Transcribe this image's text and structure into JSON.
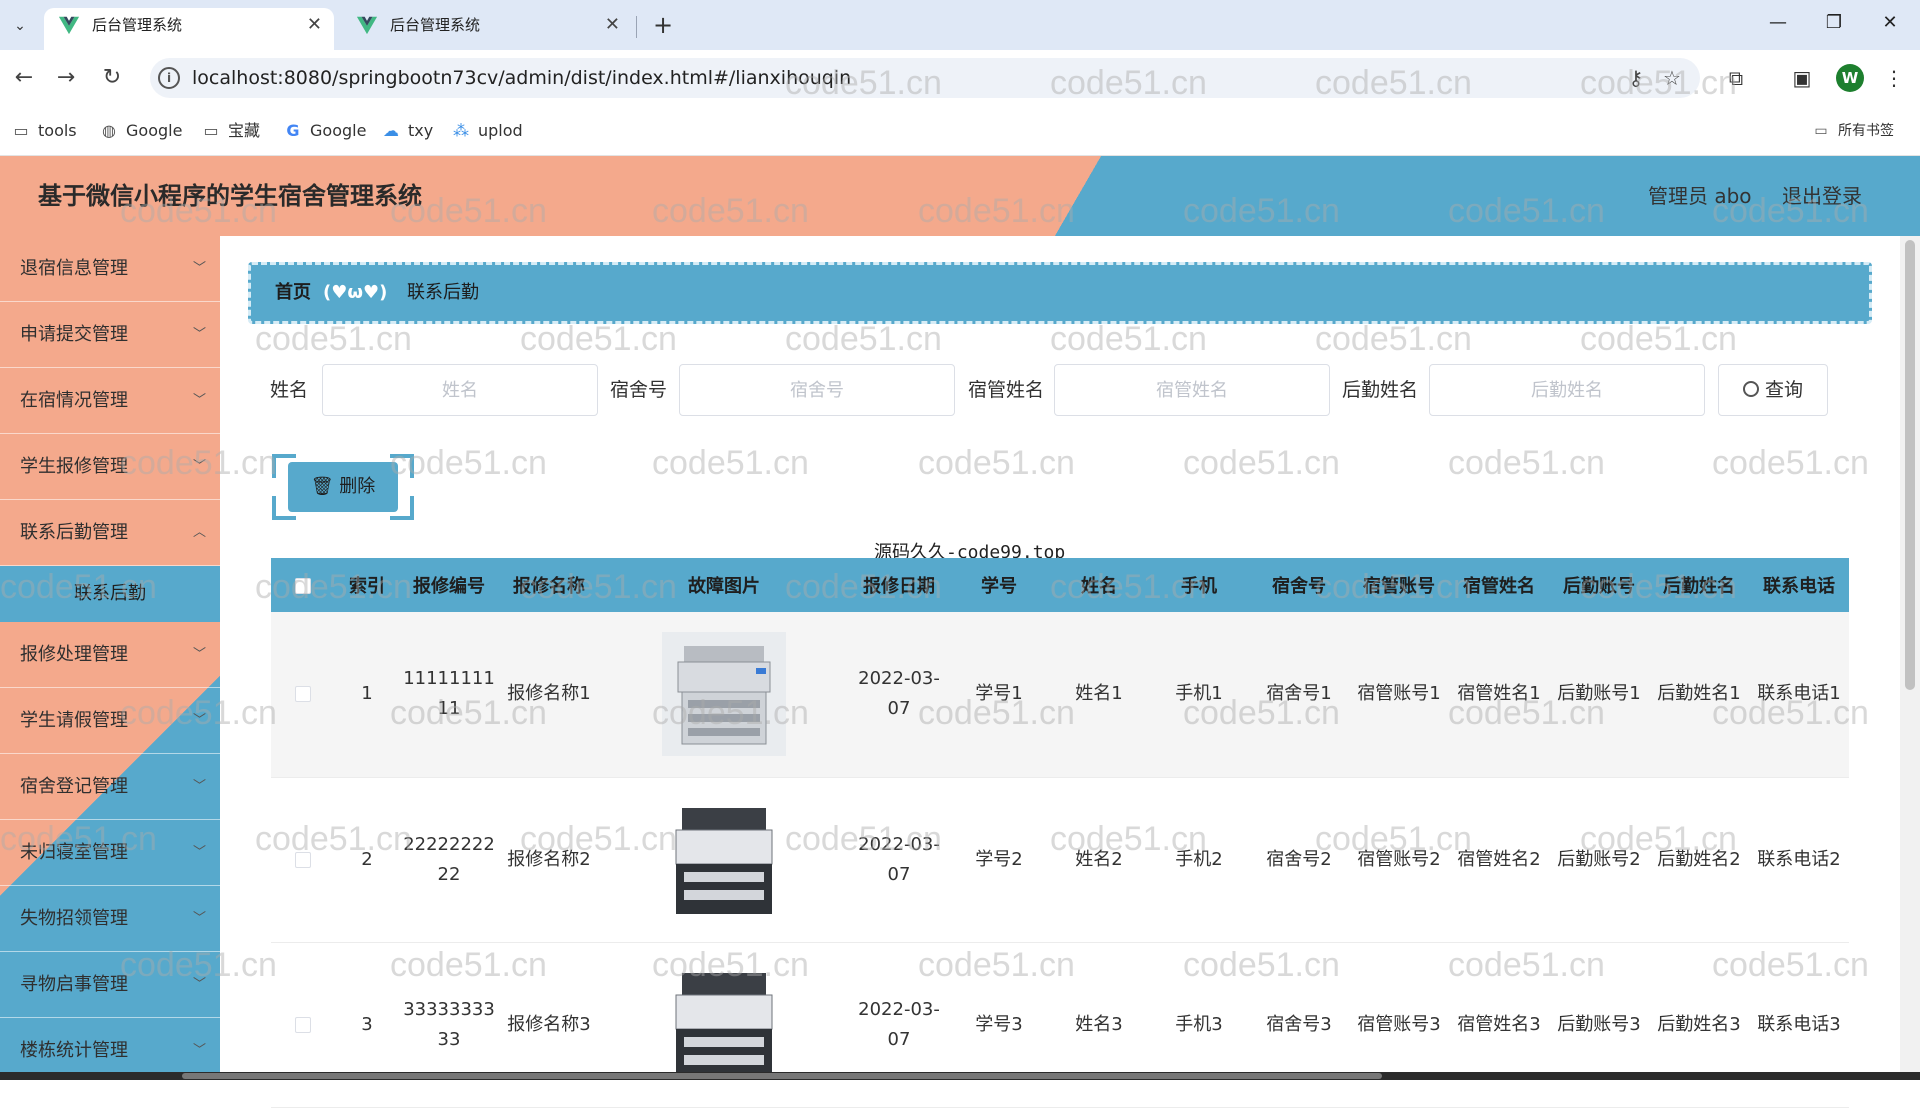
{
  "browser": {
    "tabs": [
      {
        "title": "后台管理系统",
        "active": true
      },
      {
        "title": "后台管理系统",
        "active": false
      }
    ],
    "url": "localhost:8080/springbootn73cv/admin/dist/index.html#/lianxihouqin",
    "bookmarks": [
      "tools",
      "Google",
      "宝藏",
      "Google",
      "txy",
      "uplod"
    ],
    "all_bookmarks": "所有书签",
    "profile_initial": "W"
  },
  "header": {
    "title": "基于微信小程序的学生宿舍管理系统",
    "user": "管理员 abo",
    "logout": "退出登录"
  },
  "sidebar": {
    "items": [
      {
        "label": "退宿信息管理"
      },
      {
        "label": "申请提交管理"
      },
      {
        "label": "在宿情况管理"
      },
      {
        "label": "学生报修管理"
      },
      {
        "label": "联系后勤管理"
      },
      {
        "label": "报修处理管理"
      },
      {
        "label": "学生请假管理"
      },
      {
        "label": "宿舍登记管理"
      },
      {
        "label": "未归寝室管理"
      },
      {
        "label": "失物招领管理"
      },
      {
        "label": "寻物启事管理"
      },
      {
        "label": "楼栋统计管理"
      }
    ],
    "active_sub": "联系后勤"
  },
  "breadcrumb": {
    "home": "首页",
    "separator": "(♥ω♥)",
    "current": "联系后勤"
  },
  "filters": {
    "name_label": "姓名",
    "name_placeholder": "姓名",
    "dorm_label": "宿舍号",
    "dorm_placeholder": "宿舍号",
    "manager_label": "宿管姓名",
    "manager_placeholder": "宿管姓名",
    "logistics_label": "后勤姓名",
    "logistics_placeholder": "后勤姓名",
    "query": "查询"
  },
  "actions": {
    "delete": "删除"
  },
  "table": {
    "note": "源码久久-code99.top",
    "columns": [
      "索引",
      "报修编号",
      "报修名称",
      "故障图片",
      "报修日期",
      "学号",
      "姓名",
      "手机",
      "宿舍号",
      "宿管账号",
      "宿管姓名",
      "后勤账号",
      "后勤姓名",
      "联系电话"
    ],
    "rows": [
      {
        "index": "1",
        "code": "1111111111",
        "name": "报修名称1",
        "date": "2022-03-07",
        "student_no": "学号1",
        "student": "姓名1",
        "phone": "手机1",
        "dorm": "宿舍号1",
        "mgr_acct": "宿管账号1",
        "mgr_name": "宿管姓名1",
        "log_acct": "后勤账号1",
        "log_name": "后勤姓名1",
        "contact": "联系电话1"
      },
      {
        "index": "2",
        "code": "2222222222",
        "name": "报修名称2",
        "date": "2022-03-07",
        "student_no": "学号2",
        "student": "姓名2",
        "phone": "手机2",
        "dorm": "宿舍号2",
        "mgr_acct": "宿管账号2",
        "mgr_name": "宿管姓名2",
        "log_acct": "后勤账号2",
        "log_name": "后勤姓名2",
        "contact": "联系电话2"
      },
      {
        "index": "3",
        "code": "3333333333",
        "name": "报修名称3",
        "date": "2022-03-07",
        "student_no": "学号3",
        "student": "姓名3",
        "phone": "手机3",
        "dorm": "宿舍号3",
        "mgr_acct": "宿管账号3",
        "mgr_name": "宿管姓名3",
        "log_acct": "后勤账号3",
        "log_name": "后勤姓名3",
        "contact": "联系电话3"
      }
    ]
  },
  "watermark": "code51.cn",
  "colors": {
    "salmon": "#f4a98c",
    "blue": "#57a9cc"
  }
}
